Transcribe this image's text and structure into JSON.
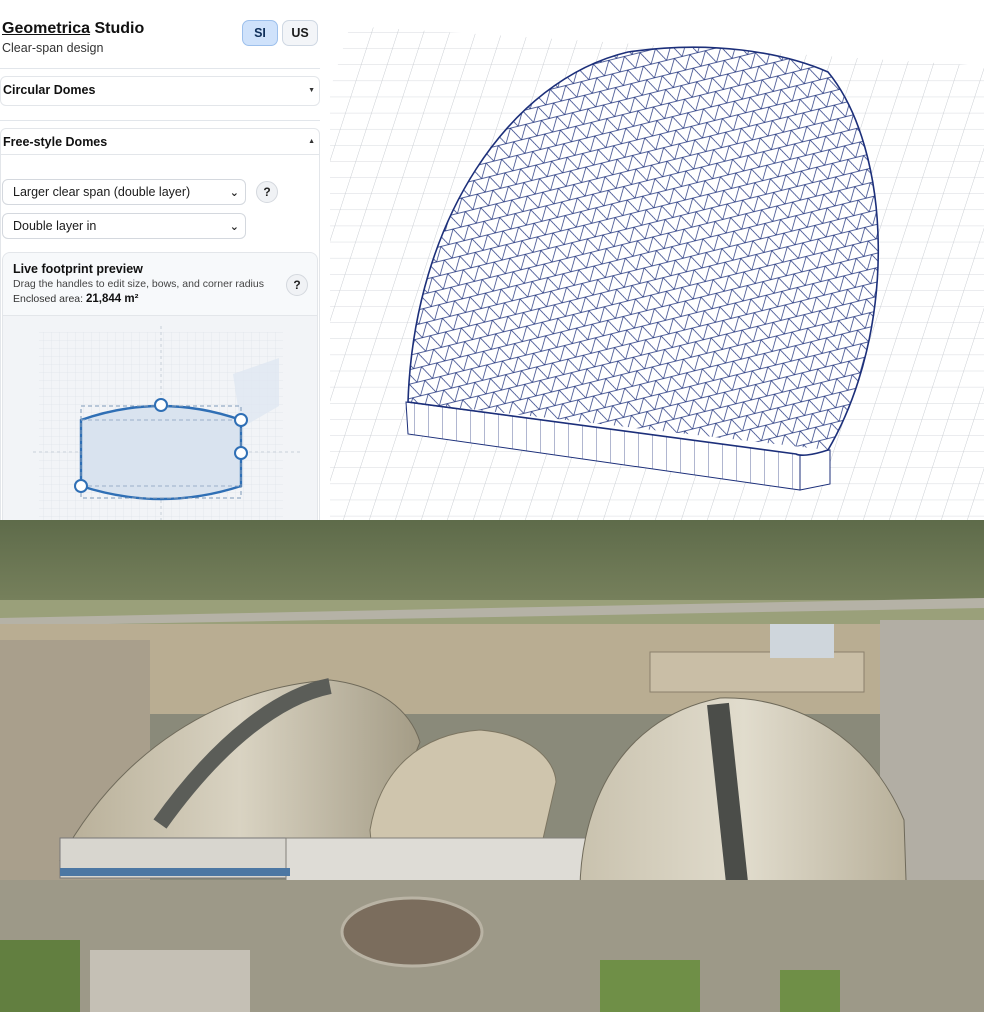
{
  "brand": {
    "name_underlined": "Geometrica",
    "name_rest": " Studio",
    "subtitle": "Clear-span design"
  },
  "units": {
    "si": "SI",
    "us": "US",
    "active": "SI"
  },
  "sections": {
    "circular": {
      "label": "Circular Domes",
      "state": "collapsed"
    },
    "freestyle": {
      "label": "Free-style Domes",
      "state": "expanded"
    }
  },
  "controls": {
    "type_select": "Larger clear span (double layer)",
    "layer_select": "Double layer in",
    "help_symbol": "?"
  },
  "preview": {
    "title": "Live footprint preview",
    "description": "Drag the handles to edit size, bows, and corner radius",
    "area_label": "Enclosed area: ",
    "area_value": "21,844 m²"
  },
  "colors": {
    "accent": "#2f6fb5",
    "mesh": "#1c2f7a",
    "active_unit": "#cfe2fb"
  },
  "icons": {
    "dropdown": "chevron-down-icon",
    "section_collapsed": "caret-down-icon",
    "section_expanded": "caret-up-icon",
    "help": "question-icon"
  }
}
